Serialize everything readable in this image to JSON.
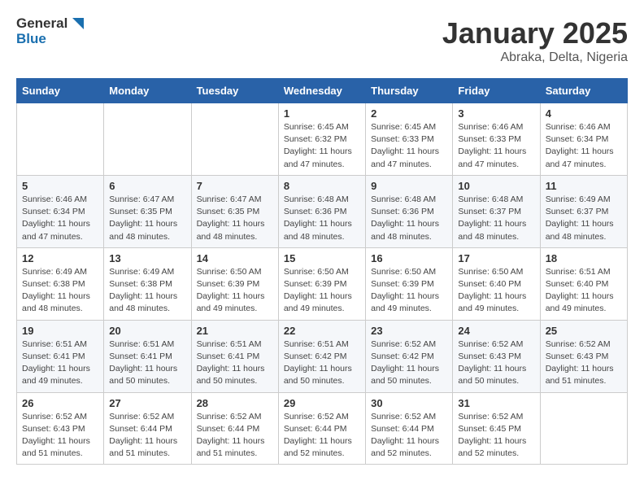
{
  "header": {
    "logo_general": "General",
    "logo_blue": "Blue",
    "month": "January 2025",
    "location": "Abraka, Delta, Nigeria"
  },
  "weekdays": [
    "Sunday",
    "Monday",
    "Tuesday",
    "Wednesday",
    "Thursday",
    "Friday",
    "Saturday"
  ],
  "weeks": [
    [
      {
        "day": "",
        "info": ""
      },
      {
        "day": "",
        "info": ""
      },
      {
        "day": "",
        "info": ""
      },
      {
        "day": "1",
        "info": "Sunrise: 6:45 AM\nSunset: 6:32 PM\nDaylight: 11 hours\nand 47 minutes."
      },
      {
        "day": "2",
        "info": "Sunrise: 6:45 AM\nSunset: 6:33 PM\nDaylight: 11 hours\nand 47 minutes."
      },
      {
        "day": "3",
        "info": "Sunrise: 6:46 AM\nSunset: 6:33 PM\nDaylight: 11 hours\nand 47 minutes."
      },
      {
        "day": "4",
        "info": "Sunrise: 6:46 AM\nSunset: 6:34 PM\nDaylight: 11 hours\nand 47 minutes."
      }
    ],
    [
      {
        "day": "5",
        "info": "Sunrise: 6:46 AM\nSunset: 6:34 PM\nDaylight: 11 hours\nand 47 minutes."
      },
      {
        "day": "6",
        "info": "Sunrise: 6:47 AM\nSunset: 6:35 PM\nDaylight: 11 hours\nand 48 minutes."
      },
      {
        "day": "7",
        "info": "Sunrise: 6:47 AM\nSunset: 6:35 PM\nDaylight: 11 hours\nand 48 minutes."
      },
      {
        "day": "8",
        "info": "Sunrise: 6:48 AM\nSunset: 6:36 PM\nDaylight: 11 hours\nand 48 minutes."
      },
      {
        "day": "9",
        "info": "Sunrise: 6:48 AM\nSunset: 6:36 PM\nDaylight: 11 hours\nand 48 minutes."
      },
      {
        "day": "10",
        "info": "Sunrise: 6:48 AM\nSunset: 6:37 PM\nDaylight: 11 hours\nand 48 minutes."
      },
      {
        "day": "11",
        "info": "Sunrise: 6:49 AM\nSunset: 6:37 PM\nDaylight: 11 hours\nand 48 minutes."
      }
    ],
    [
      {
        "day": "12",
        "info": "Sunrise: 6:49 AM\nSunset: 6:38 PM\nDaylight: 11 hours\nand 48 minutes."
      },
      {
        "day": "13",
        "info": "Sunrise: 6:49 AM\nSunset: 6:38 PM\nDaylight: 11 hours\nand 48 minutes."
      },
      {
        "day": "14",
        "info": "Sunrise: 6:50 AM\nSunset: 6:39 PM\nDaylight: 11 hours\nand 49 minutes."
      },
      {
        "day": "15",
        "info": "Sunrise: 6:50 AM\nSunset: 6:39 PM\nDaylight: 11 hours\nand 49 minutes."
      },
      {
        "day": "16",
        "info": "Sunrise: 6:50 AM\nSunset: 6:39 PM\nDaylight: 11 hours\nand 49 minutes."
      },
      {
        "day": "17",
        "info": "Sunrise: 6:50 AM\nSunset: 6:40 PM\nDaylight: 11 hours\nand 49 minutes."
      },
      {
        "day": "18",
        "info": "Sunrise: 6:51 AM\nSunset: 6:40 PM\nDaylight: 11 hours\nand 49 minutes."
      }
    ],
    [
      {
        "day": "19",
        "info": "Sunrise: 6:51 AM\nSunset: 6:41 PM\nDaylight: 11 hours\nand 49 minutes."
      },
      {
        "day": "20",
        "info": "Sunrise: 6:51 AM\nSunset: 6:41 PM\nDaylight: 11 hours\nand 50 minutes."
      },
      {
        "day": "21",
        "info": "Sunrise: 6:51 AM\nSunset: 6:41 PM\nDaylight: 11 hours\nand 50 minutes."
      },
      {
        "day": "22",
        "info": "Sunrise: 6:51 AM\nSunset: 6:42 PM\nDaylight: 11 hours\nand 50 minutes."
      },
      {
        "day": "23",
        "info": "Sunrise: 6:52 AM\nSunset: 6:42 PM\nDaylight: 11 hours\nand 50 minutes."
      },
      {
        "day": "24",
        "info": "Sunrise: 6:52 AM\nSunset: 6:43 PM\nDaylight: 11 hours\nand 50 minutes."
      },
      {
        "day": "25",
        "info": "Sunrise: 6:52 AM\nSunset: 6:43 PM\nDaylight: 11 hours\nand 51 minutes."
      }
    ],
    [
      {
        "day": "26",
        "info": "Sunrise: 6:52 AM\nSunset: 6:43 PM\nDaylight: 11 hours\nand 51 minutes."
      },
      {
        "day": "27",
        "info": "Sunrise: 6:52 AM\nSunset: 6:44 PM\nDaylight: 11 hours\nand 51 minutes."
      },
      {
        "day": "28",
        "info": "Sunrise: 6:52 AM\nSunset: 6:44 PM\nDaylight: 11 hours\nand 51 minutes."
      },
      {
        "day": "29",
        "info": "Sunrise: 6:52 AM\nSunset: 6:44 PM\nDaylight: 11 hours\nand 52 minutes."
      },
      {
        "day": "30",
        "info": "Sunrise: 6:52 AM\nSunset: 6:44 PM\nDaylight: 11 hours\nand 52 minutes."
      },
      {
        "day": "31",
        "info": "Sunrise: 6:52 AM\nSunset: 6:45 PM\nDaylight: 11 hours\nand 52 minutes."
      },
      {
        "day": "",
        "info": ""
      }
    ]
  ]
}
